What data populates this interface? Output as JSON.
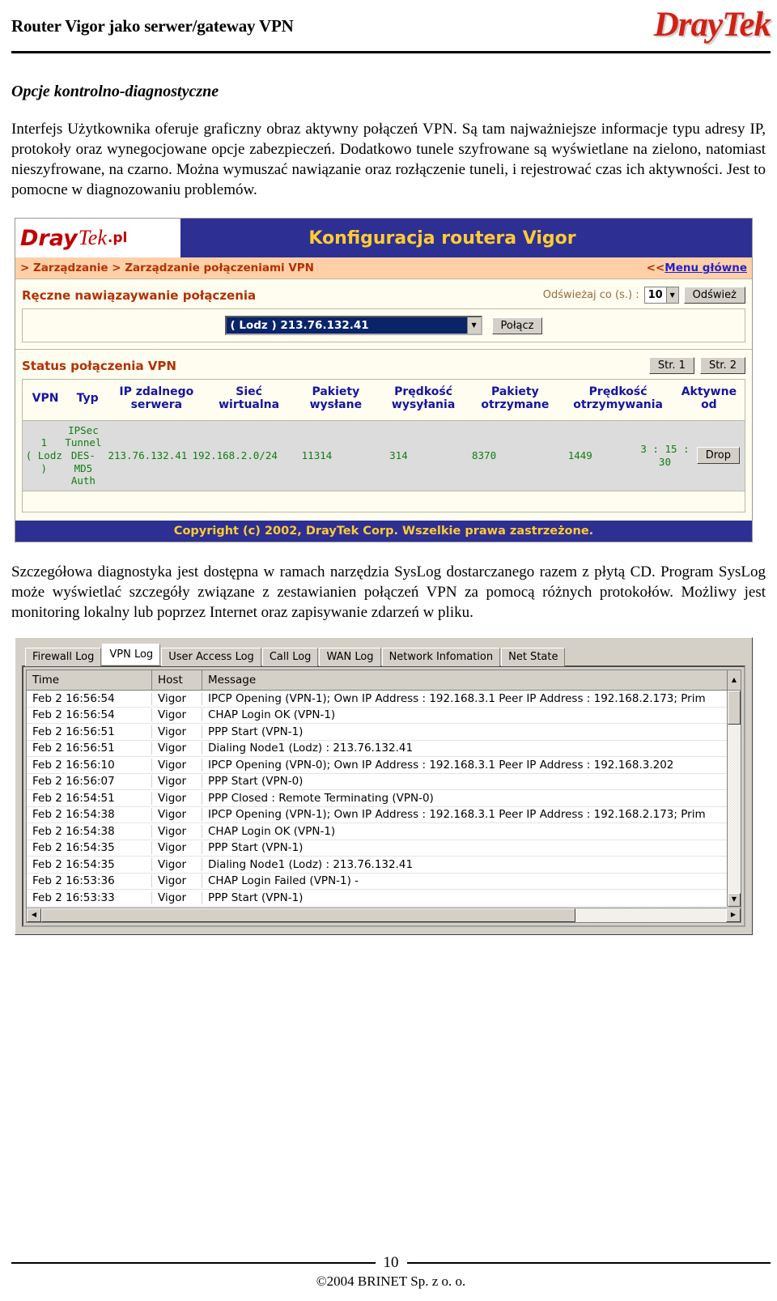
{
  "header": {
    "title": "Router Vigor jako serwer/gateway VPN",
    "logo": "DrayTek"
  },
  "section": {
    "heading": "Opcje kontrolno-diagnostyczne",
    "paragraph1": "Interfejs Użytkownika oferuje graficzny obraz aktywny połączeń VPN. Są tam najważniejsze informacje typu adresy IP, protokoły oraz wynegocjowane opcje zabezpieczeń. Dodatkowo tunele szyfrowane są wyświetlane na zielono, natomiast nieszyfrowane, na czarno. Można wymuszać nawiązanie oraz rozłączenie tuneli, i rejestrować czas ich aktywności. Jest to pomocne w diagnozowaniu problemów.",
    "paragraph2": "Szczegółowa diagnostyka jest dostępna w ramach narzędzia SysLog dostarczanego razem z płytą CD. Program SysLog może wyświetlać szczegóły związane z zestawianien połączeń VPN za pomocą różnych protokołów. Możliwy jest monitoring lokalny lub poprzez Internet oraz zapisywanie zdarzeń w pliku."
  },
  "router_ui": {
    "logo_dray": "Dray",
    "logo_tek": "Tek",
    "logo_pl": ".pl",
    "title": "Konfiguracja routera Vigor",
    "breadcrumb": "> Zarządzanie > Zarządzanie połączeniami VPN",
    "main_menu_prefix": "<<",
    "main_menu_link": "Menu główne",
    "manual_connect_label": "Ręczne nawiązaywanie połączenia",
    "refresh_label": "Odświeżaj co (s.) :",
    "refresh_value": "10",
    "refresh_button": "Odśwież",
    "profile_selected": "( Lodz ) 213.76.132.41",
    "connect_button": "Połącz",
    "status_label": "Status połączenia VPN",
    "page_buttons": [
      "Str. 1",
      "Str. 2"
    ],
    "table_headers": [
      "VPN",
      "Typ",
      "IP zdalnego serwera",
      "Sieć wirtualna",
      "Pakiety wysłane",
      "Prędkość wysyłania",
      "Pakiety otrzymane",
      "Prędkość otrzymywania",
      "Aktywne od"
    ],
    "row": {
      "vpn": "1\n( Lodz )",
      "typ": "IPSec Tunnel\nDES-MD5 Auth",
      "remote_ip": "213.76.132.41",
      "virtual_net": "192.168.2.0/24",
      "packets_sent": "11314",
      "speed_sent": "314",
      "packets_recv": "8370",
      "speed_recv": "1449",
      "uptime": "3 : 15 : 30",
      "drop_button": "Drop"
    },
    "copyright": "Copyright (c) 2002, DrayTek Corp. Wszelkie prawa zastrzeżone."
  },
  "syslog": {
    "tabs": [
      "Firewall Log",
      "VPN Log",
      "User Access Log",
      "Call Log",
      "WAN Log",
      "Network Infomation",
      "Net State"
    ],
    "active_tab": "VPN Log",
    "columns": [
      "Time",
      "Host",
      "Message"
    ],
    "rows": [
      {
        "time": "Feb  2 16:56:54",
        "host": "Vigor",
        "message": "IPCP Opening (VPN-1); Own IP Address : 192.168.3.1  Peer IP Address : 192.168.2.173; Prim"
      },
      {
        "time": "Feb  2 16:56:54",
        "host": "Vigor",
        "message": "CHAP Login OK (VPN-1)"
      },
      {
        "time": "Feb  2 16:56:51",
        "host": "Vigor",
        "message": "PPP Start (VPN-1)"
      },
      {
        "time": "Feb  2 16:56:51",
        "host": "Vigor",
        "message": "Dialing Node1 (Lodz) : 213.76.132.41"
      },
      {
        "time": "Feb  2 16:56:10",
        "host": "Vigor",
        "message": "IPCP Opening (VPN-0); Own IP Address : 192.168.3.1  Peer IP Address : 192.168.3.202"
      },
      {
        "time": "Feb  2 16:56:07",
        "host": "Vigor",
        "message": "PPP Start (VPN-0)"
      },
      {
        "time": "Feb  2 16:54:51",
        "host": "Vigor",
        "message": "PPP Closed : Remote Terminating (VPN-0)"
      },
      {
        "time": "Feb  2 16:54:38",
        "host": "Vigor",
        "message": "IPCP Opening (VPN-1); Own IP Address : 192.168.3.1  Peer IP Address : 192.168.2.173; Prim"
      },
      {
        "time": "Feb  2 16:54:38",
        "host": "Vigor",
        "message": "CHAP Login OK (VPN-1)"
      },
      {
        "time": "Feb  2 16:54:35",
        "host": "Vigor",
        "message": "PPP Start (VPN-1)"
      },
      {
        "time": "Feb  2 16:54:35",
        "host": "Vigor",
        "message": "Dialing Node1 (Lodz) : 213.76.132.41"
      },
      {
        "time": "Feb  2 16:53:36",
        "host": "Vigor",
        "message": "CHAP Login Failed (VPN-1) -"
      },
      {
        "time": "Feb  2 16:53:33",
        "host": "Vigor",
        "message": "PPP Start (VPN-1)"
      }
    ]
  },
  "footer": {
    "page_number": "10",
    "copyright": "©2004 BRINET Sp. z  o. o."
  }
}
